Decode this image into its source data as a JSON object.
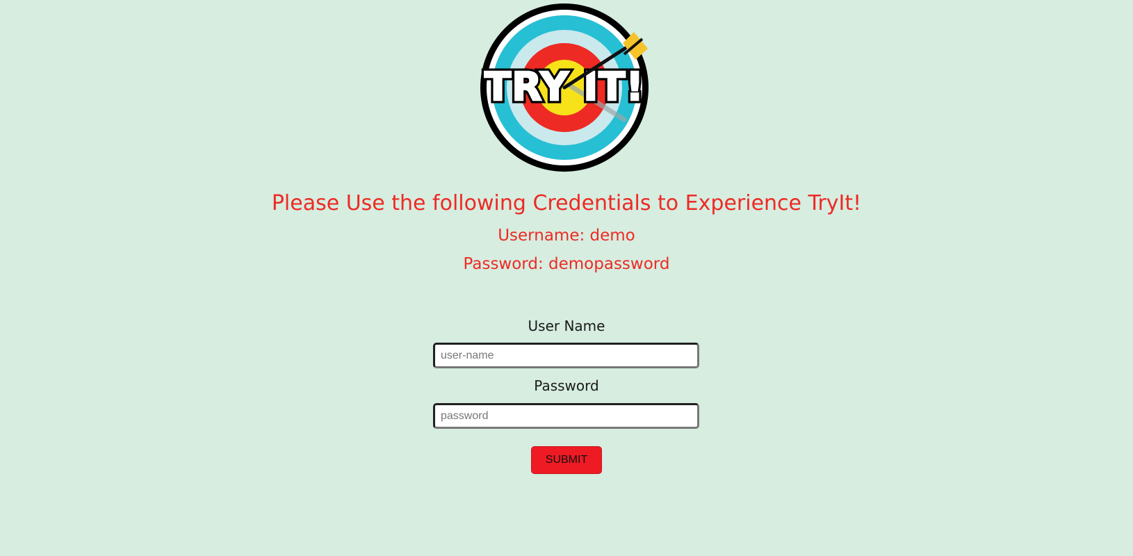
{
  "logo": {
    "text": "TRY IT!",
    "icon": "archery-target-with-arrow",
    "colors": {
      "outer_ring": "#000000",
      "cyan_ring": "#27bfd4",
      "light_ring": "#c9e9ed",
      "red_ring": "#ee2a24",
      "bullseye": "#f7e21a",
      "arrow_fletching": "#f6c32a"
    }
  },
  "notice": {
    "title": "Please Use the following Credentials to Experience TryIt!",
    "username_line": "Username: demo",
    "password_line": "Password: demopassword",
    "color": "#ee2a24"
  },
  "form": {
    "username_label": "User Name",
    "username_placeholder": "user-name",
    "username_value": "",
    "password_label": "Password",
    "password_placeholder": "password",
    "password_value": "",
    "submit_label": "SUBMIT",
    "submit_color": "#ee1b24"
  },
  "page": {
    "background": "#d6ede0"
  }
}
